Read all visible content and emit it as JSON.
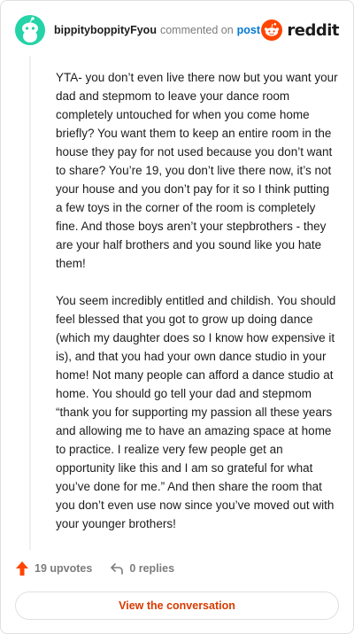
{
  "header": {
    "username": "bippityboppityFyou",
    "action_text": "commented on",
    "post_link": "post",
    "brand_text": "reddit"
  },
  "comment": {
    "paragraphs": [
      "YTA- you don’t even live there now but you want your dad and stepmom to leave your dance room completely untouched for when you come home briefly? You want them to keep an entire room in the house they pay for not used because you don’t want to share? You’re 19, you don’t live there now, it’s not your house and you don’t pay for it so I think putting a few toys in the corner of the room is completely fine. And those boys aren’t your stepbrothers - they are your half brothers and you sound like you hate them!",
      "You seem incredibly entitled and childish. You should feel blessed that you got to grow up doing dance (which my daughter does so I know how expensive it is), and that you had your own dance studio in your home! Not many people can afford a dance studio at home. You should go tell your dad and stepmom “thank you for supporting my passion all these years and allowing me to have an amazing space at home to practice. I realize very few people get an opportunity like this and I am so grateful for what you’ve done for me.” And then share the room that you don’t even use now since you’ve moved out with your younger brothers!"
    ]
  },
  "footer": {
    "upvotes": "19 upvotes",
    "replies": "0 replies",
    "view_button": "View the conversation"
  },
  "icons": {
    "avatar": "snoo-avatar-icon",
    "brand": "reddit-logo-icon",
    "upvote": "upvote-arrow-icon",
    "reply": "reply-arrow-icon"
  },
  "colors": {
    "avatar_bg": "#24d3a8",
    "brand_orange": "#ff4500",
    "upvote": "#ff4500",
    "link_blue": "#0079d3",
    "button_text": "#d93a00",
    "muted": "#7c7c7c"
  }
}
